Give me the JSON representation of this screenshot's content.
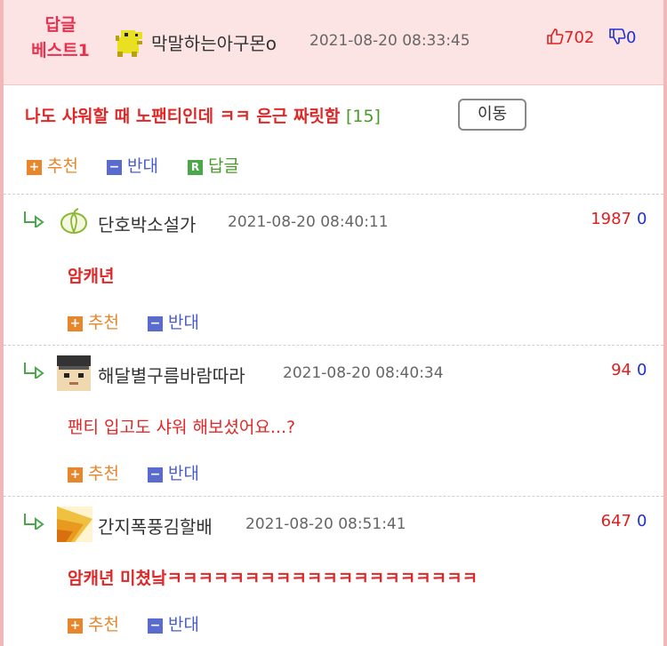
{
  "best": {
    "badge_line1": "답글",
    "badge_line2": "베스트1",
    "author": "막말하는아구몬o",
    "date": "2021-08-20 08:33:45",
    "up": "702",
    "down": "0",
    "title": "나도 샤워할 때 노팬티인데 ㅋㅋ 은근 짜릿함",
    "count": "[15]",
    "move_label": "이동",
    "actions": {
      "up": "추천",
      "down": "반대",
      "reply": "답글"
    }
  },
  "comments": [
    {
      "author": "단호박소설가",
      "date": "2021-08-20 08:40:11",
      "up": "1987",
      "down": "0",
      "text": "암캐년",
      "actions": {
        "up": "추천",
        "down": "반대"
      }
    },
    {
      "author": "해달별구름바람따라",
      "date": "2021-08-20 08:40:34",
      "up": "94",
      "down": "0",
      "text": "팬티 입고도 샤워 해보셨어요...?",
      "actions": {
        "up": "추천",
        "down": "반대"
      }
    },
    {
      "author": "간지폭풍김할배",
      "date": "2021-08-20 08:51:41",
      "up": "647",
      "down": "0",
      "text": "암캐년 미쳤낰ㅋㅋㅋㅋㅋㅋㅋㅋㅋㅋㅋㅋㅋㅋㅋㅋㅋㅋㅋㅋ",
      "actions": {
        "up": "추천",
        "down": "반대"
      }
    }
  ],
  "icons": {
    "reply_arrow": "reply-arrow-icon",
    "thumb_up": "thumbs-up-icon",
    "thumb_down": "thumbs-down-icon",
    "plus": "plus-icon",
    "minus": "minus-icon",
    "reply_badge": "R"
  },
  "colors": {
    "header_bg": "#fde4e4",
    "frame": "#f2b8b8",
    "accent_red": "#e02828",
    "up_orange": "#e8862b",
    "down_blue": "#4a5cc8",
    "reply_green": "#4a9a2a"
  }
}
